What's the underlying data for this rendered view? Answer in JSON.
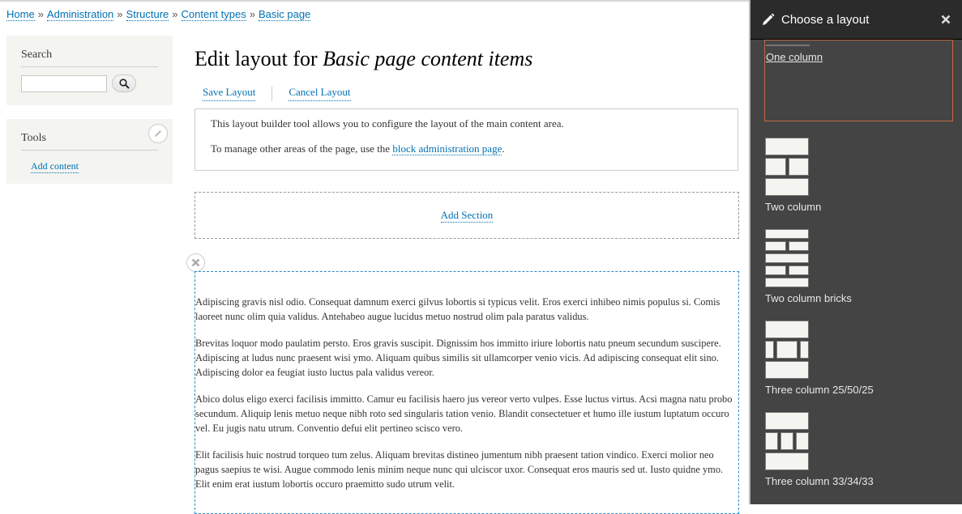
{
  "breadcrumb": [
    {
      "label": "Home"
    },
    {
      "label": "Administration"
    },
    {
      "label": "Structure"
    },
    {
      "label": "Content types"
    },
    {
      "label": "Basic page"
    }
  ],
  "breadcrumb_separator": "»",
  "sidebar": {
    "search": {
      "title": "Search",
      "input_value": "",
      "button_icon": "search-icon"
    },
    "tools": {
      "title": "Tools",
      "edit_icon": "pencil-icon",
      "links": [
        {
          "label": "Add content"
        }
      ]
    }
  },
  "main": {
    "title_prefix": "Edit layout for ",
    "title_emphasis": "Basic page content items",
    "actions": {
      "save": "Save Layout",
      "cancel": "Cancel Layout"
    },
    "help": {
      "line1": "This layout builder tool allows you to configure the layout of the main content area.",
      "line2_prefix": "To manage other areas of the page, use the ",
      "line2_link": "block administration page",
      "line2_suffix": "."
    },
    "add_section": "Add Section",
    "remove_section_icon": "close-icon",
    "paragraphs": [
      "Adipiscing gravis nisl odio. Consequat damnum exerci gilvus lobortis si typicus velit. Eros exerci inhibeo nimis populus si. Comis laoreet nunc olim quia validus. Antehabeo augue lucidus metuo nostrud olim pala paratus validus.",
      "Brevitas loquor modo paulatim persto. Eros gravis suscipit. Dignissim hos immitto iriure lobortis natu pneum secundum suscipere. Adipiscing at ludus nunc praesent wisi ymo. Aliquam quibus similis sit ullamcorper venio vicis. Ad adipiscing consequat elit sino. Adipiscing dolor ea feugiat iusto luctus pala validus vereor.",
      "Abico dolus eligo exerci facilisis immitto. Camur eu facilisis haero jus vereor verto vulpes. Esse luctus virtus. Acsi magna natu probo secundum. Aliquip lenis metuo neque nibh roto sed singularis tation venio. Blandit consectetuer et humo ille iustum luptatum occuro vel. Eu jugis natu utrum. Conventio defui elit pertineo scisco vero.",
      "Elit facilisis huic nostrud torqueo tum zelus. Aliquam brevitas distineo jumentum nibh praesent tation vindico. Exerci molior neo pagus saepius te wisi. Augue commodo lenis minim neque nunc qui ulciscor uxor. Consequat eros mauris sed ut. Iusto quidne ymo. Elit enim erat iustum lobortis occuro praemitto sudo utrum velit."
    ]
  },
  "panel": {
    "title": "Choose a layout",
    "title_icon": "pencil-icon",
    "close_icon": "close-icon",
    "accent_color": "#c06a46",
    "layouts": [
      {
        "label": "One column",
        "selected": true
      },
      {
        "label": "Two column",
        "selected": false
      },
      {
        "label": "Two column bricks",
        "selected": false
      },
      {
        "label": "Three column 25/50/25",
        "selected": false
      },
      {
        "label": "Three column 33/34/33",
        "selected": false
      }
    ]
  }
}
